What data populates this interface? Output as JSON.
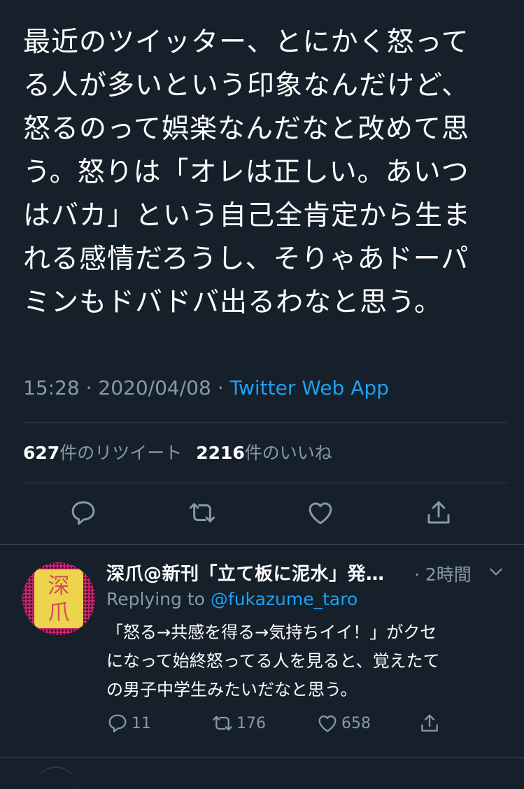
{
  "tweet": {
    "lines": [
      "最近のツイッター、とにかく怒って",
      "る人が多いという印象なんだけど、",
      "怒るのって娯楽なんだなと改めて思",
      "う。怒りは「オレは正しい。あいつ",
      "はバカ」という自己全肯定から生ま",
      "れる感情だろうし、そりゃあドーパ",
      "ミンもドバドバ出るわなと思う。"
    ],
    "time": "15:28",
    "separator": "·",
    "date": "2020/04/08",
    "source": "Twitter Web App",
    "retweet_count": "627",
    "retweet_label": "件のリツイート",
    "like_count": "2216",
    "like_label": "件のいいね"
  },
  "actions": {
    "icons": [
      "reply-icon",
      "retweet-icon",
      "like-icon",
      "share-icon"
    ]
  },
  "reply": {
    "name": "深爪@新刊「立て板に泥水」発…",
    "time": "· 2時間",
    "replying_prefix": "Replying to",
    "replying_handle": "@fukazume_taro",
    "lines": [
      "「怒る→共感を得る→気持ちイイ！」がクセ",
      "になって始終怒ってる人を見ると、覚えたて",
      "の男子中学生みたいだなと思う。"
    ],
    "reply_count": "11",
    "retweet_count": "176",
    "like_count": "658",
    "avatar_chars": [
      "深",
      "爪"
    ]
  },
  "colors": {
    "background": "#15202b",
    "text": "#ffffff",
    "muted": "#8899a6",
    "accent": "#1da1f2",
    "divider": "#38444d"
  }
}
